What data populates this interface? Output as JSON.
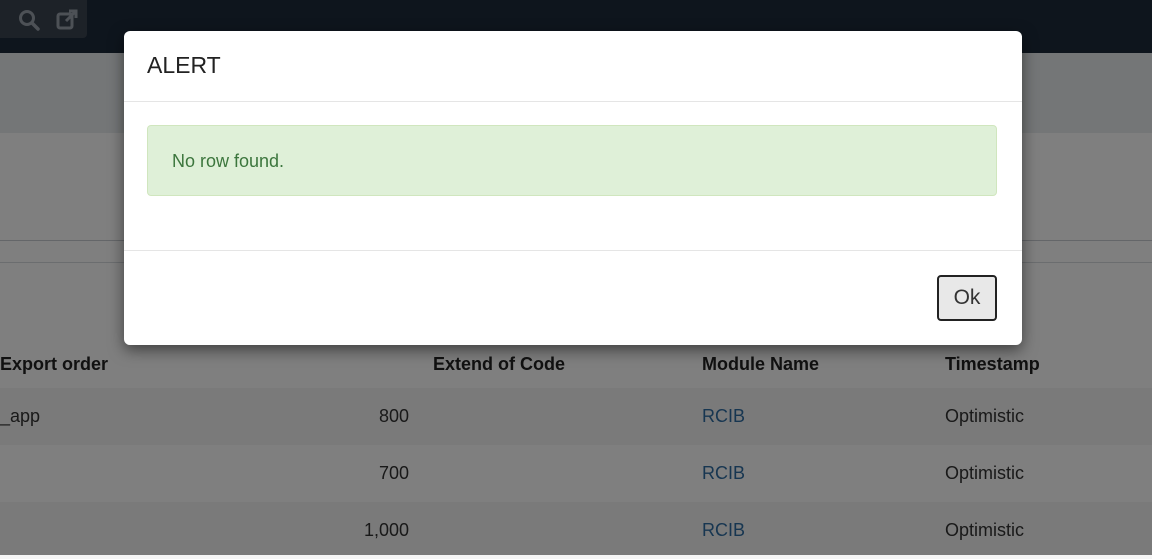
{
  "toolbar": {
    "icons": [
      "search-icon",
      "external-link-icon"
    ]
  },
  "table": {
    "headers": [
      "Export order",
      "Extend of Code",
      "Module Name",
      "Timestamp"
    ],
    "rows": [
      {
        "name": "_app",
        "export_order": "800",
        "extend": "",
        "module": "RCIB",
        "timestamp": "Optimistic"
      },
      {
        "name": "",
        "export_order": "700",
        "extend": "",
        "module": "RCIB",
        "timestamp": "Optimistic"
      },
      {
        "name": "",
        "export_order": "1,000",
        "extend": "",
        "module": "RCIB",
        "timestamp": "Optimistic"
      }
    ]
  },
  "modal": {
    "title": "ALERT",
    "message": "No row found.",
    "ok_label": "Ok"
  },
  "colors": {
    "topbar": "#1d2a3a",
    "alert_bg": "#dff0d8",
    "alert_text": "#3c763d",
    "link": "#2f6da3"
  }
}
